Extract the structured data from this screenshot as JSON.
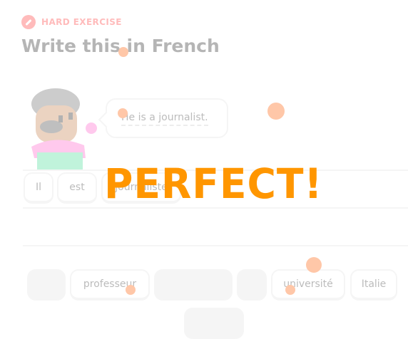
{
  "header": {
    "badge_label": "HARD EXERCISE",
    "badge_icon": "dumbbell-icon",
    "title": "Write this in French"
  },
  "prompt": {
    "sentence": "He is a journalist."
  },
  "answer": {
    "words": [
      "Il",
      "est",
      "journaliste"
    ]
  },
  "word_bank": {
    "words": [
      "",
      "professeur",
      "",
      "",
      "université",
      "Italie",
      ""
    ]
  },
  "feedback": {
    "text": "PERFECT!",
    "color": "#ff9600"
  },
  "colors": {
    "accent": "#ff4b4b",
    "confetti": "#ffc7a8"
  }
}
